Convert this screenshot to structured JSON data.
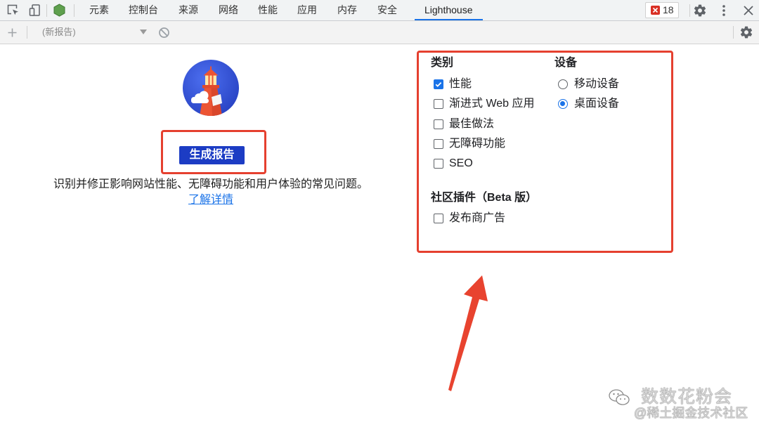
{
  "toolbar": {
    "tabs": [
      "元素",
      "控制台",
      "来源",
      "网络",
      "性能",
      "应用",
      "内存",
      "安全",
      "Lighthouse"
    ],
    "active_tab_index": 8,
    "error_count": "18"
  },
  "subbar": {
    "report_select": "(新报告)"
  },
  "main": {
    "generate_button": "生成报告",
    "description": "识别并修正影响网站性能、无障碍功能和用户体验的常见问题。",
    "learn_more": "了解详情"
  },
  "options": {
    "categories_heading": "类别",
    "categories": [
      {
        "label": "性能",
        "checked": true
      },
      {
        "label": "渐进式 Web 应用",
        "checked": false
      },
      {
        "label": "最佳做法",
        "checked": false
      },
      {
        "label": "无障碍功能",
        "checked": false
      },
      {
        "label": "SEO",
        "checked": false
      }
    ],
    "device_heading": "设备",
    "devices": [
      {
        "label": "移动设备",
        "selected": false
      },
      {
        "label": "桌面设备",
        "selected": true
      }
    ],
    "plugins_heading": "社区插件（Beta 版）",
    "plugins": [
      {
        "label": "发布商广告",
        "checked": false
      }
    ]
  },
  "watermark": {
    "line1": "数数花粉会",
    "line2": "@稀土掘金技术社区"
  },
  "icons": {
    "inspect": "inspect-element-icon",
    "device": "device-toggle-icon",
    "node": "node-hexagon-icon",
    "error": "error-x-icon",
    "settings": "gear-icon",
    "more": "more-vertical-icon",
    "close": "close-icon",
    "add": "plus-icon",
    "dropdown": "chevron-down-icon",
    "clear": "block-icon",
    "logo": "lighthouse-logo",
    "wechat": "wechat-icon"
  },
  "colors": {
    "accent": "#1a73e8",
    "button": "#1c3cc4",
    "annotation": "#e5402f",
    "error": "#d93025"
  }
}
